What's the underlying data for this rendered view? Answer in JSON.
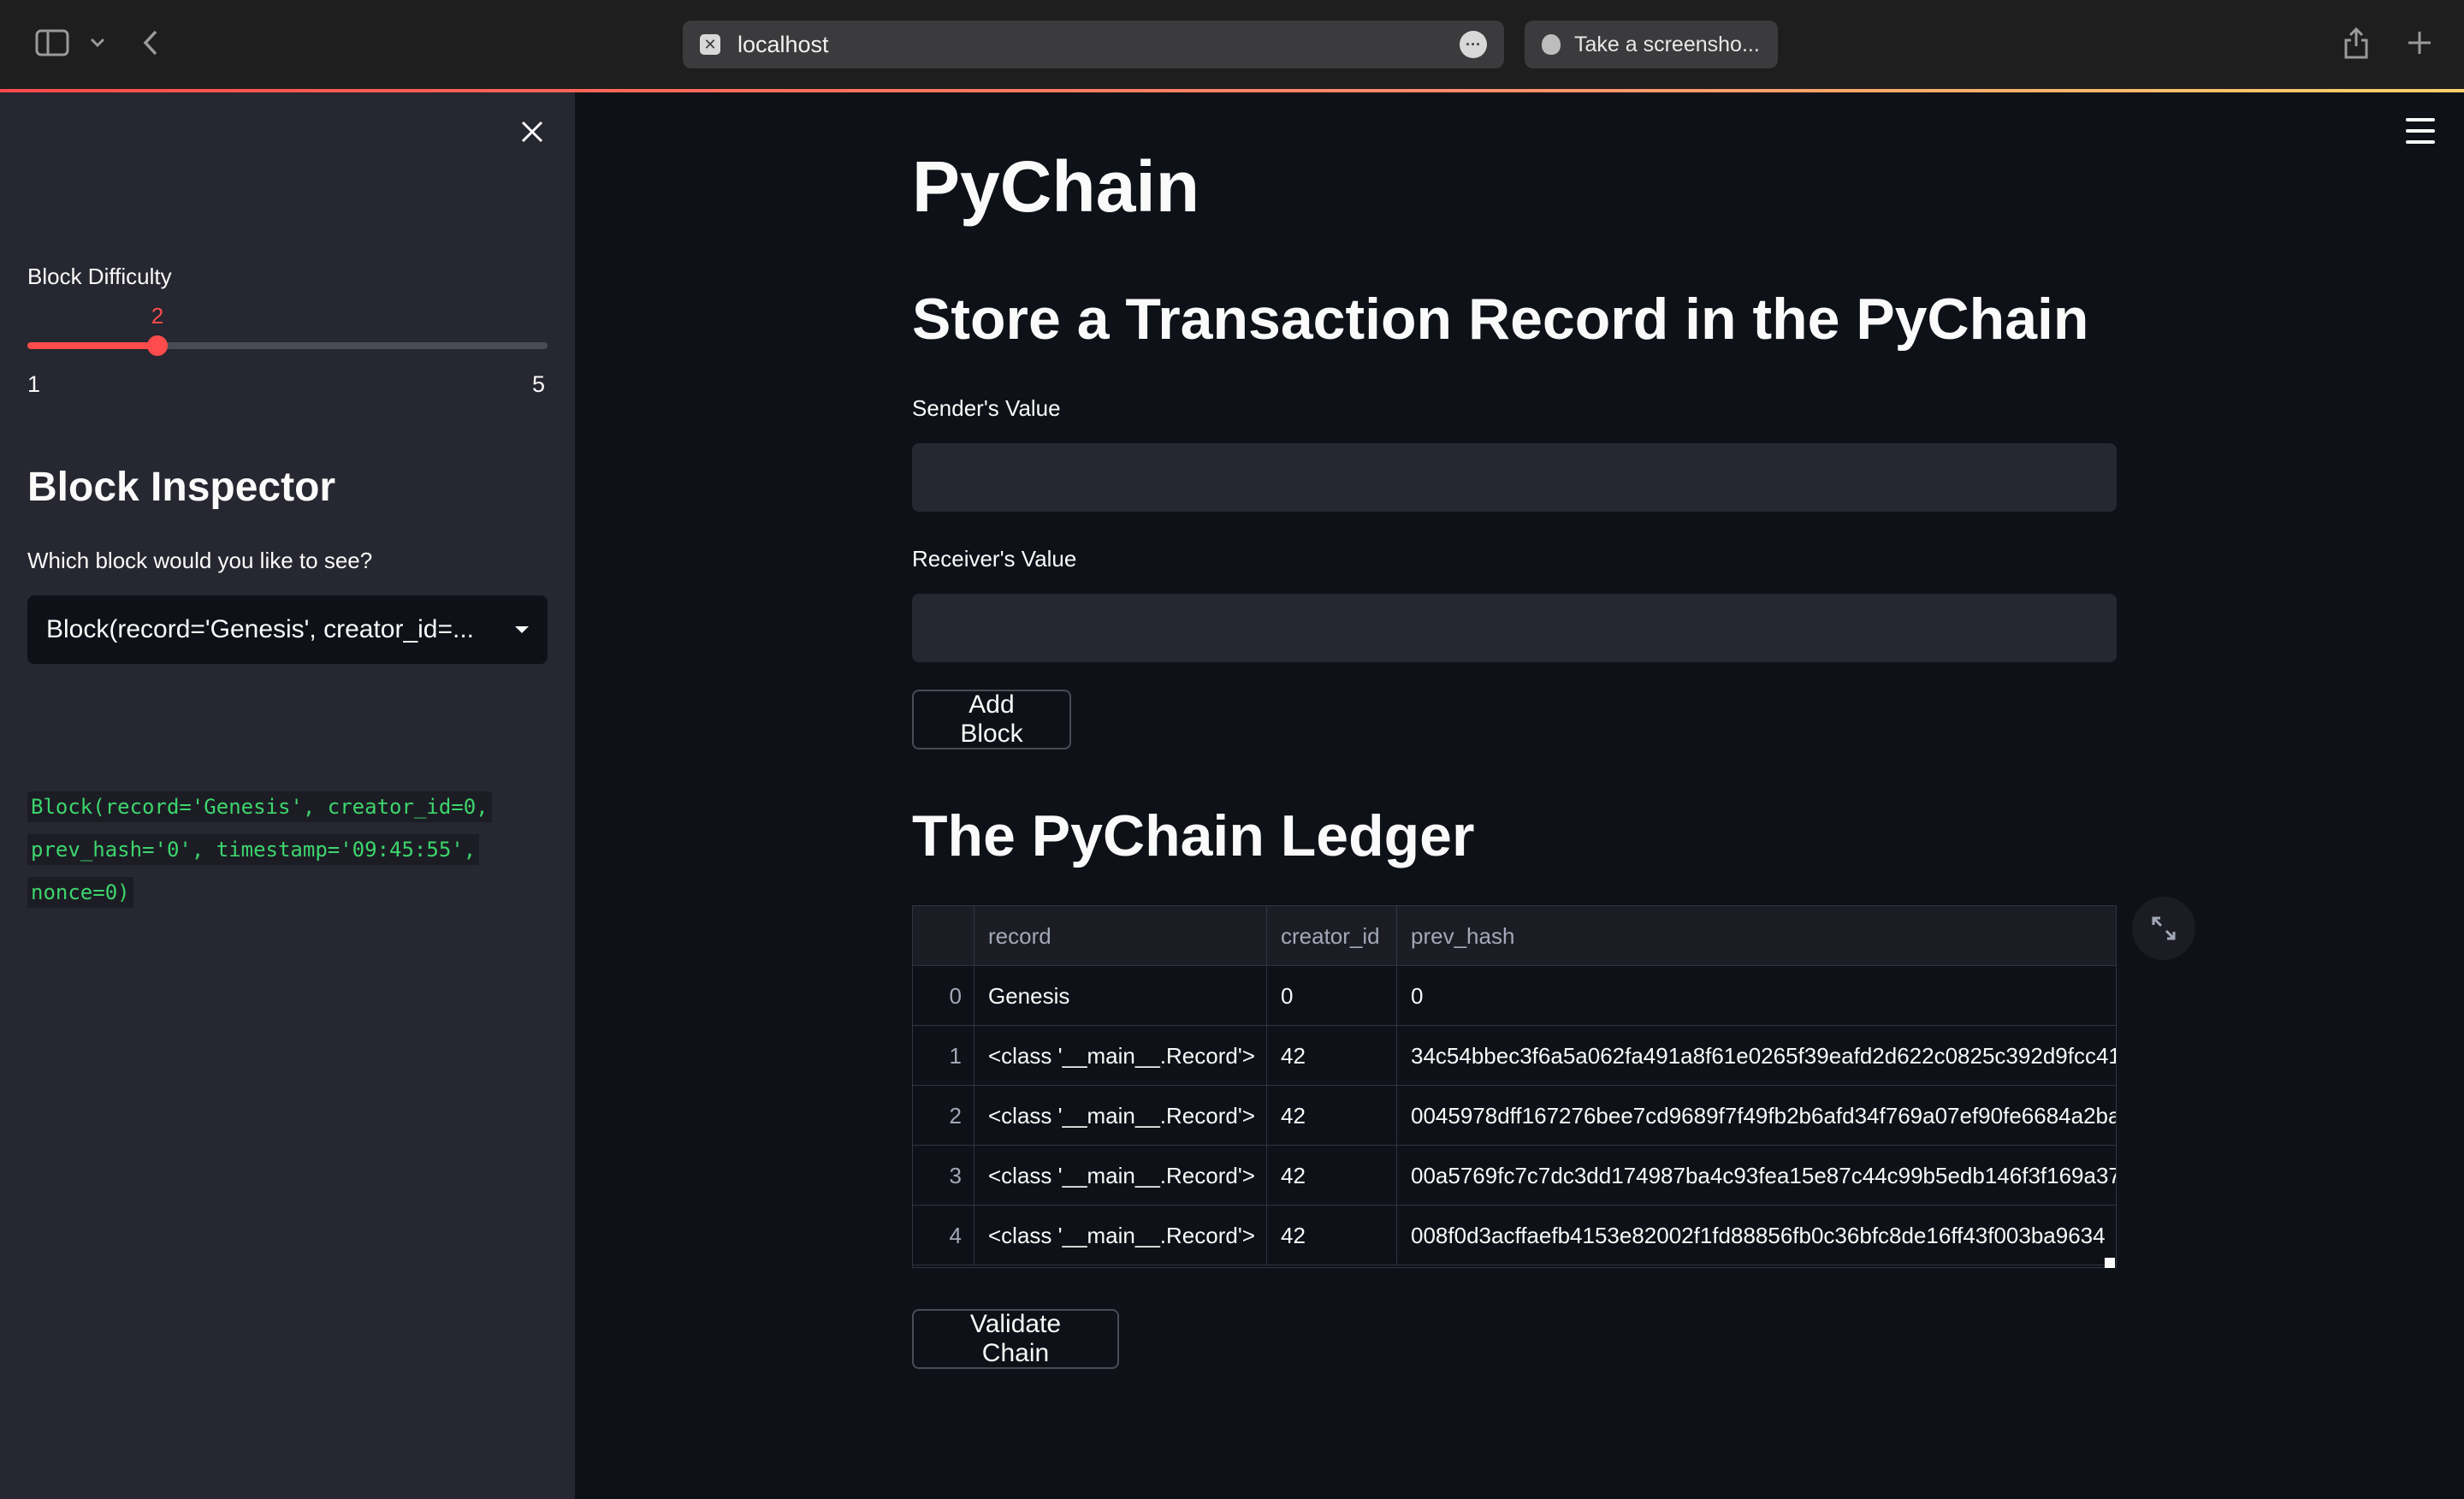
{
  "browser": {
    "url": "localhost",
    "tab_label": "Take a screensho..."
  },
  "sidebar": {
    "difficulty_label": "Block Difficulty",
    "slider": {
      "value": "2",
      "min": "1",
      "max": "5",
      "level": 0.25
    },
    "inspector_title": "Block Inspector",
    "select_label": "Which block would you like to see?",
    "selected_block": "Block(record='Genesis', creator_id=...",
    "block_code_lines": [
      "Block(record='Genesis', creator_id=0,",
      "prev_hash='0', timestamp='09:45:55',",
      "nonce=0)"
    ]
  },
  "main": {
    "title": "PyChain",
    "store_heading": "Store a Transaction Record in the PyChain",
    "sender_label": "Sender's Value",
    "sender_value": "",
    "receiver_label": "Receiver's Value",
    "receiver_value": "",
    "add_block_label": "Add Block",
    "ledger_heading": "The PyChain Ledger",
    "validate_label": "Validate Chain"
  },
  "ledger": {
    "columns": [
      "",
      "record",
      "creator_id",
      "prev_hash"
    ],
    "rows": [
      [
        "0",
        "Genesis",
        "0",
        "0"
      ],
      [
        "1",
        "<class '__main__.Record'>",
        "42",
        "34c54bbec3f6a5a062fa491a8f61e0265f39eafd2d622c0825c392d9fcc41"
      ],
      [
        "2",
        "<class '__main__.Record'>",
        "42",
        "0045978dff167276bee7cd9689f7f49fb2b6afd34f769a07ef90fe6684a2ba"
      ],
      [
        "3",
        "<class '__main__.Record'>",
        "42",
        "00a5769fc7c7dc3dd174987ba4c93fea15e87c44c99b5edb146f3f169a37"
      ],
      [
        "4",
        "<class '__main__.Record'>",
        "42",
        "008f0d3acffaefb4153e82002f1fd88856fb0c36bfc8de16ff43f003ba9634"
      ]
    ]
  },
  "colors": {
    "accent": "#ff4b4b",
    "background": "#0e1117",
    "sidebar": "#262730",
    "code_green": "#3dd56d"
  }
}
